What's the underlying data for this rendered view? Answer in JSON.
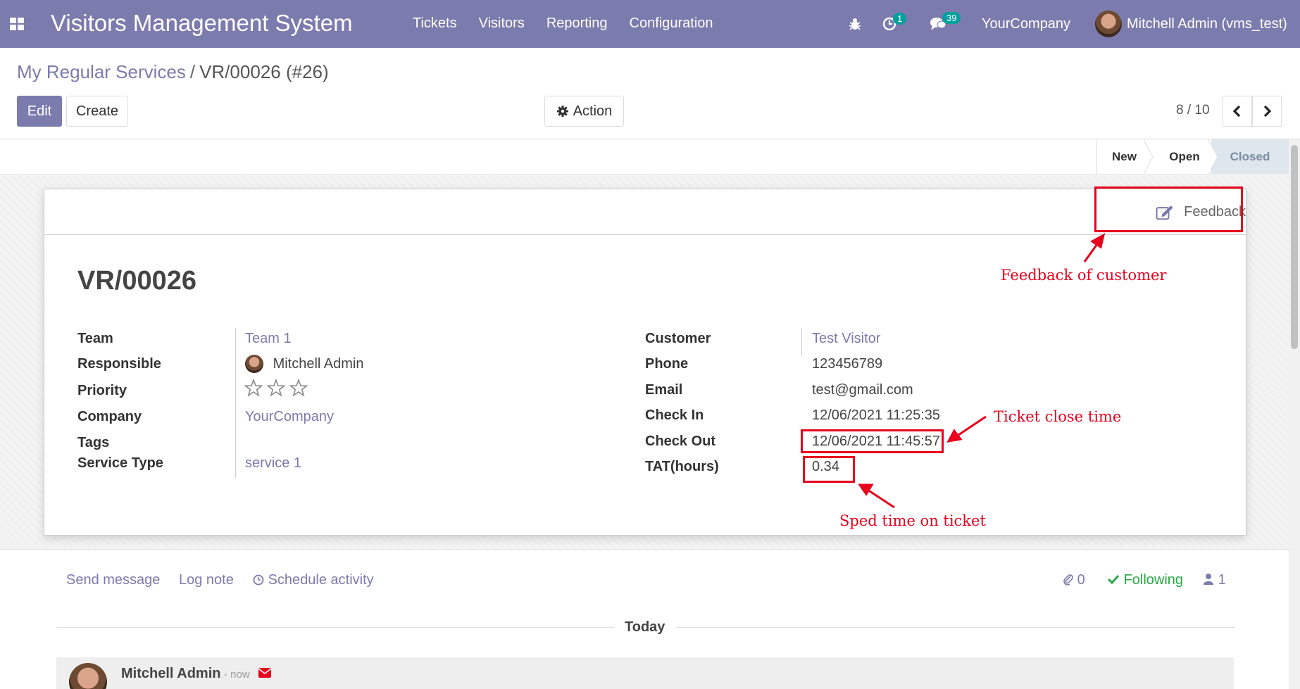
{
  "navbar": {
    "brand": "Visitors Management System",
    "menu": [
      "Tickets",
      "Visitors",
      "Reporting",
      "Configuration"
    ],
    "activity_count": "1",
    "message_count": "39",
    "company": "YourCompany",
    "user": "Mitchell Admin (vms_test)"
  },
  "control": {
    "breadcrumb_parent": "My Regular Services",
    "breadcrumb_sep": "/",
    "breadcrumb_current": "VR/00026 (#26)",
    "edit_label": "Edit",
    "create_label": "Create",
    "action_label": "Action",
    "pager": "8 / 10"
  },
  "statusbar": {
    "stages": [
      "New",
      "Open",
      "Closed"
    ],
    "active_stage": "Closed"
  },
  "form": {
    "feedback_label": "Feedback",
    "title": "VR/00026",
    "left": {
      "team_label": "Team",
      "team": "Team 1",
      "responsible_label": "Responsible",
      "responsible": "Mitchell Admin",
      "priority_label": "Priority",
      "priority_stars": 0,
      "company_label": "Company",
      "company": "YourCompany",
      "tags_label": "Tags",
      "service_type_label": "Service Type",
      "service_type": "service 1"
    },
    "right": {
      "customer_label": "Customer",
      "customer": "Test Visitor",
      "phone_label": "Phone",
      "phone": "123456789",
      "email_label": "Email",
      "email": "test@gmail.com",
      "check_in_label": "Check In",
      "check_in": "12/06/2021 11:25:35",
      "check_out_label": "Check Out",
      "check_out": "12/06/2021 11:45:57",
      "tat_label": "TAT(hours)",
      "tat": "0.34"
    }
  },
  "annotations": {
    "feedback": "Feedback of customer",
    "close_time": "Ticket close time",
    "spend_time": "Sped time on ticket"
  },
  "chatter": {
    "send_message": "Send message",
    "log_note": "Log note",
    "schedule_activity": "Schedule activity",
    "attachments": "0",
    "following": "Following",
    "followers": "1",
    "today": "Today",
    "author": "Mitchell Admin",
    "time": "- now"
  },
  "colors": {
    "accent": "#7c7bad",
    "annotation": "#e8001c",
    "following": "#28a745"
  }
}
